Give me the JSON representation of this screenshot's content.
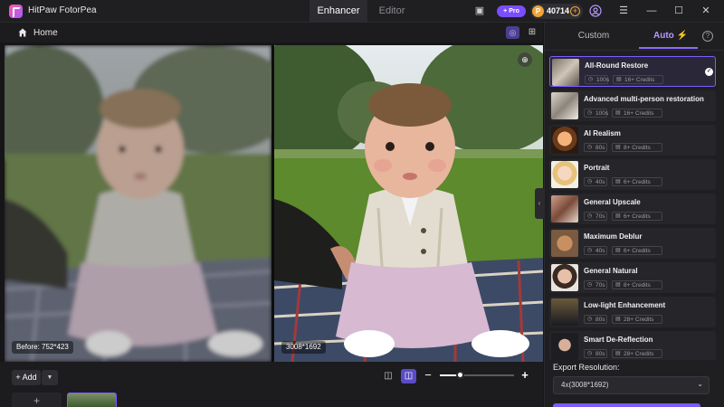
{
  "app": {
    "name": "HitPaw FotorPea",
    "tabs": [
      {
        "label": "Enhancer",
        "active": true
      },
      {
        "label": "Editor",
        "active": false
      }
    ],
    "pro_label": "Pro",
    "credits": "40714",
    "window_icons": [
      "chat-icon",
      "user-icon",
      "menu-icon",
      "minimize-icon",
      "maximize-icon",
      "close-icon"
    ]
  },
  "subheader": {
    "home_label": "Home"
  },
  "preview": {
    "before_label": "Before: 752*423",
    "after_label": "3008*1692"
  },
  "toolbar": {
    "add_label": "Add",
    "zoom_fraction": 0.27
  },
  "panel": {
    "tabs": {
      "custom": "Custom",
      "auto": "Auto"
    },
    "accent": "#7c5cff",
    "models": [
      {
        "name": "All-Round Restore",
        "time": "100s",
        "credits": "16+ Credits",
        "selected": true
      },
      {
        "name": "Advanced multi-person restoration",
        "time": "100s",
        "credits": "16+ Credits",
        "selected": false
      },
      {
        "name": "AI Realism",
        "time": "80s",
        "credits": "8+ Credits",
        "selected": false
      },
      {
        "name": "Portrait",
        "time": "40s",
        "credits": "6+ Credits",
        "selected": false
      },
      {
        "name": "General Upscale",
        "time": "70s",
        "credits": "6+ Credits",
        "selected": false
      },
      {
        "name": "Maximum Deblur",
        "time": "40s",
        "credits": "6+ Credits",
        "selected": false
      },
      {
        "name": "General Natural",
        "time": "70s",
        "credits": "8+ Credits",
        "selected": false
      },
      {
        "name": "Low-light Enhancement",
        "time": "80s",
        "credits": "28+ Credits",
        "selected": false
      },
      {
        "name": "Smart De-Reflection",
        "time": "80s",
        "credits": "28+ Credits",
        "selected": false
      }
    ],
    "export_label": "Export Resolution:",
    "export_value": "4x(3008*1692)"
  }
}
